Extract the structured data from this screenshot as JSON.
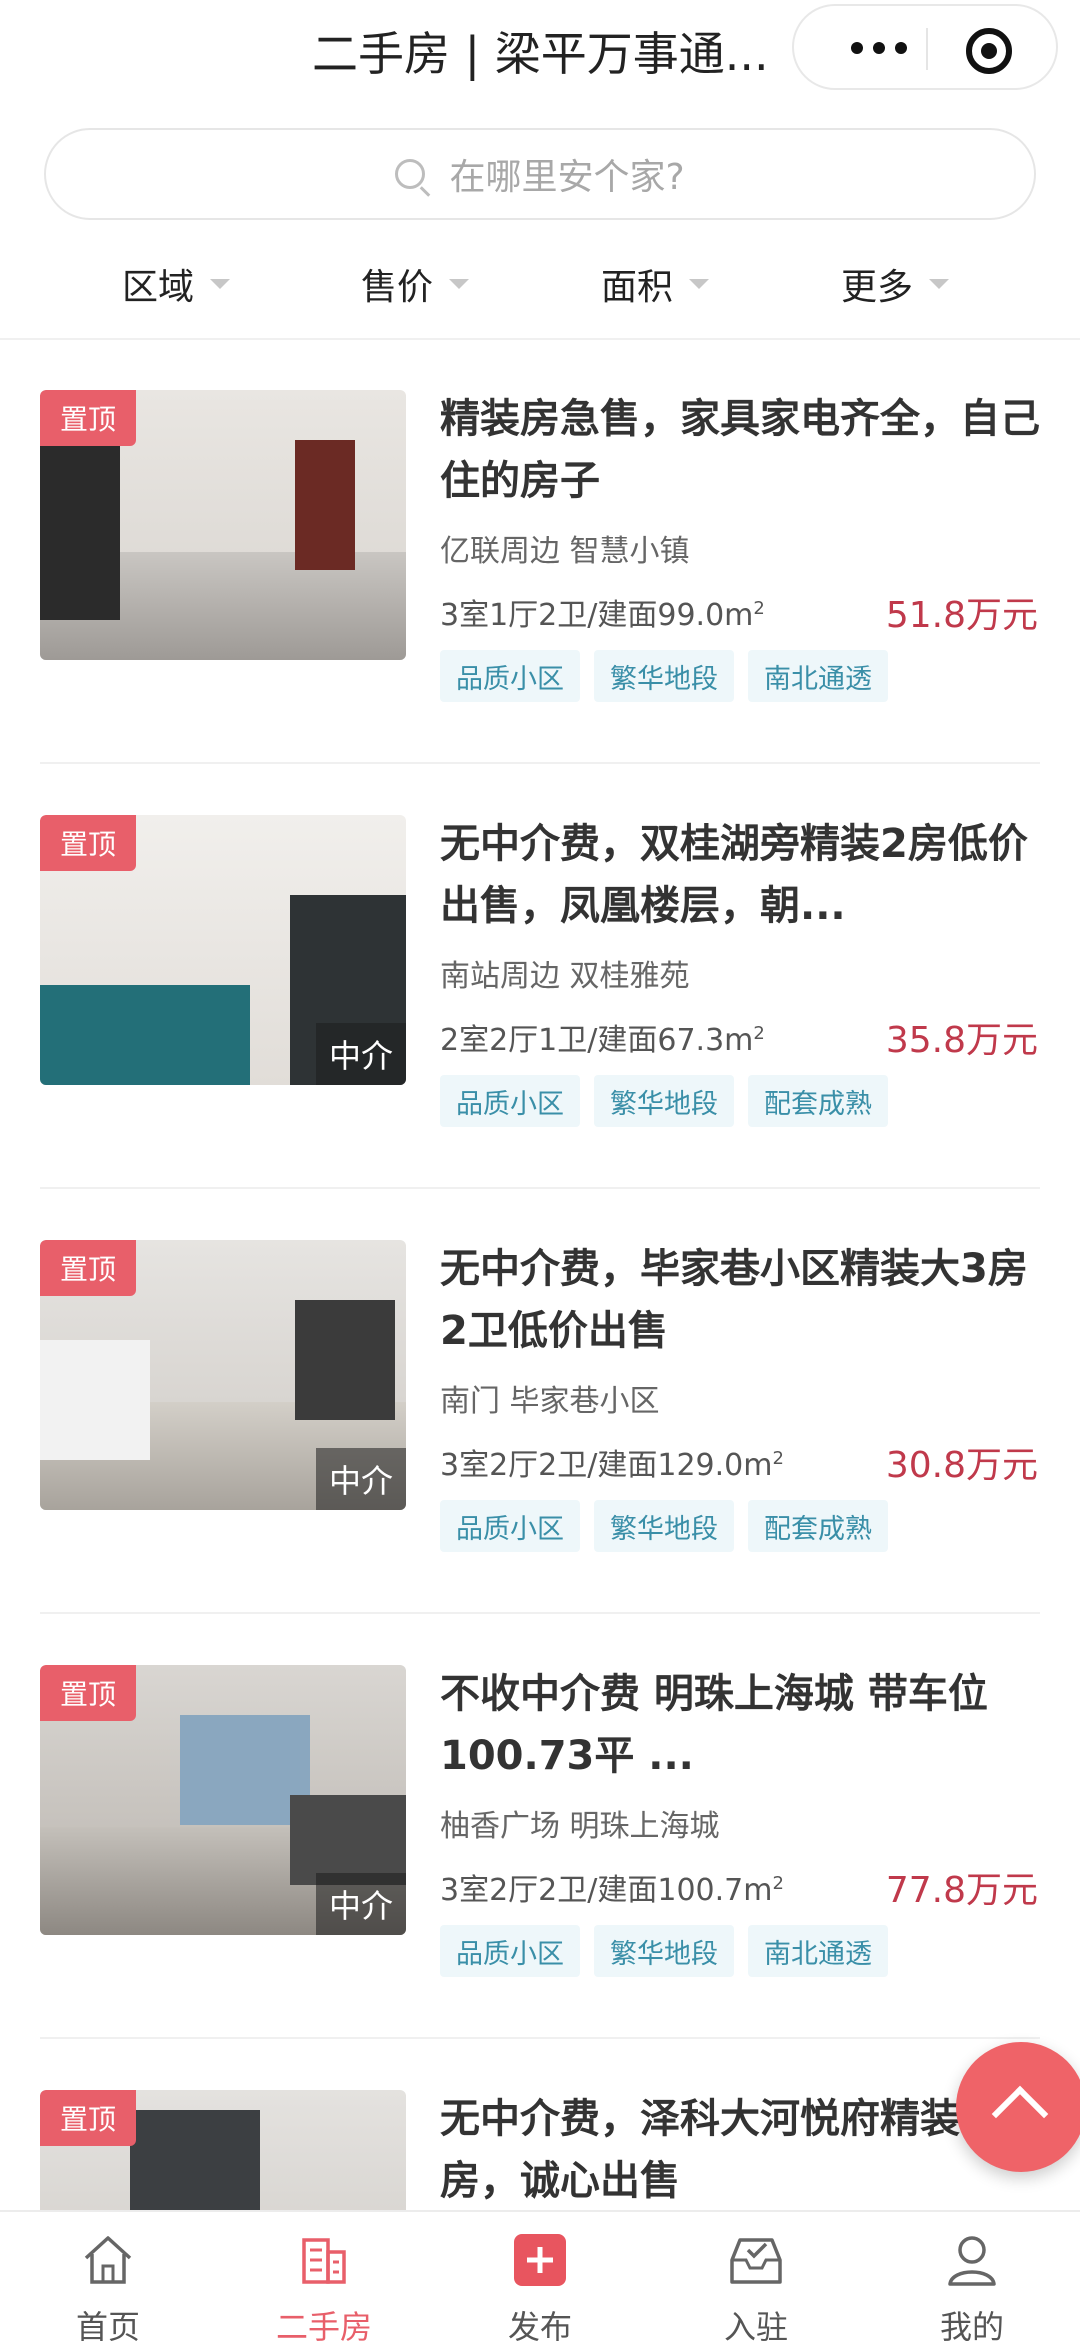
{
  "header": {
    "title": "二手房 | 梁平万事通..."
  },
  "search": {
    "placeholder": "在哪里安个家?"
  },
  "filters": [
    {
      "label": "区域"
    },
    {
      "label": "售价"
    },
    {
      "label": "面积"
    },
    {
      "label": "更多"
    }
  ],
  "listings": [
    {
      "badge": "置顶",
      "agent_label": "",
      "title": "精装房急售，家具家电齐全，自己住的房子",
      "location": "亿联周边 智慧小镇",
      "spec": "3室1厅2卫/建面99.0m",
      "spec_sup": "2",
      "price": "51.8万元",
      "tags": [
        "品质小区",
        "繁华地段",
        "南北通透"
      ]
    },
    {
      "badge": "置顶",
      "agent_label": "中介",
      "title": "无中介费，双桂湖旁精装2房低价出售，凤凰楼层，朝...",
      "location": "南站周边 双桂雅苑",
      "spec": "2室2厅1卫/建面67.3m",
      "spec_sup": "2",
      "price": "35.8万元",
      "tags": [
        "品质小区",
        "繁华地段",
        "配套成熟"
      ]
    },
    {
      "badge": "置顶",
      "agent_label": "中介",
      "title": "无中介费，毕家巷小区精装大3房2卫低价出售",
      "location": "南门 毕家巷小区",
      "spec": "3室2厅2卫/建面129.0m",
      "spec_sup": "2",
      "price": "30.8万元",
      "tags": [
        "品质小区",
        "繁华地段",
        "配套成熟"
      ]
    },
    {
      "badge": "置顶",
      "agent_label": "中介",
      "title": "不收中介费 明珠上海城 带车位 100.73平 ...",
      "location": "柚香广场 明珠上海城",
      "spec": "3室2厅2卫/建面100.7m",
      "spec_sup": "2",
      "price": "77.8万元",
      "tags": [
        "品质小区",
        "繁华地段",
        "南北通透"
      ]
    },
    {
      "badge": "置顶",
      "agent_label": "",
      "title": "无中介费，泽科大河悦府精装3房，诚心出售",
      "location": "",
      "spec": "",
      "spec_sup": "",
      "price": "",
      "tags": []
    }
  ],
  "tabbar": [
    {
      "label": "首页",
      "icon": "home-icon"
    },
    {
      "label": "二手房",
      "icon": "building-icon",
      "active": true
    },
    {
      "label": "发布",
      "icon": "plus-icon"
    },
    {
      "label": "入驻",
      "icon": "inbox-icon"
    },
    {
      "label": "我的",
      "icon": "user-icon"
    }
  ],
  "colors": {
    "accent": "#e85f6a",
    "price": "#c0394b",
    "tag_bg": "#eef7fa",
    "tag_text": "#3a8fa8"
  }
}
